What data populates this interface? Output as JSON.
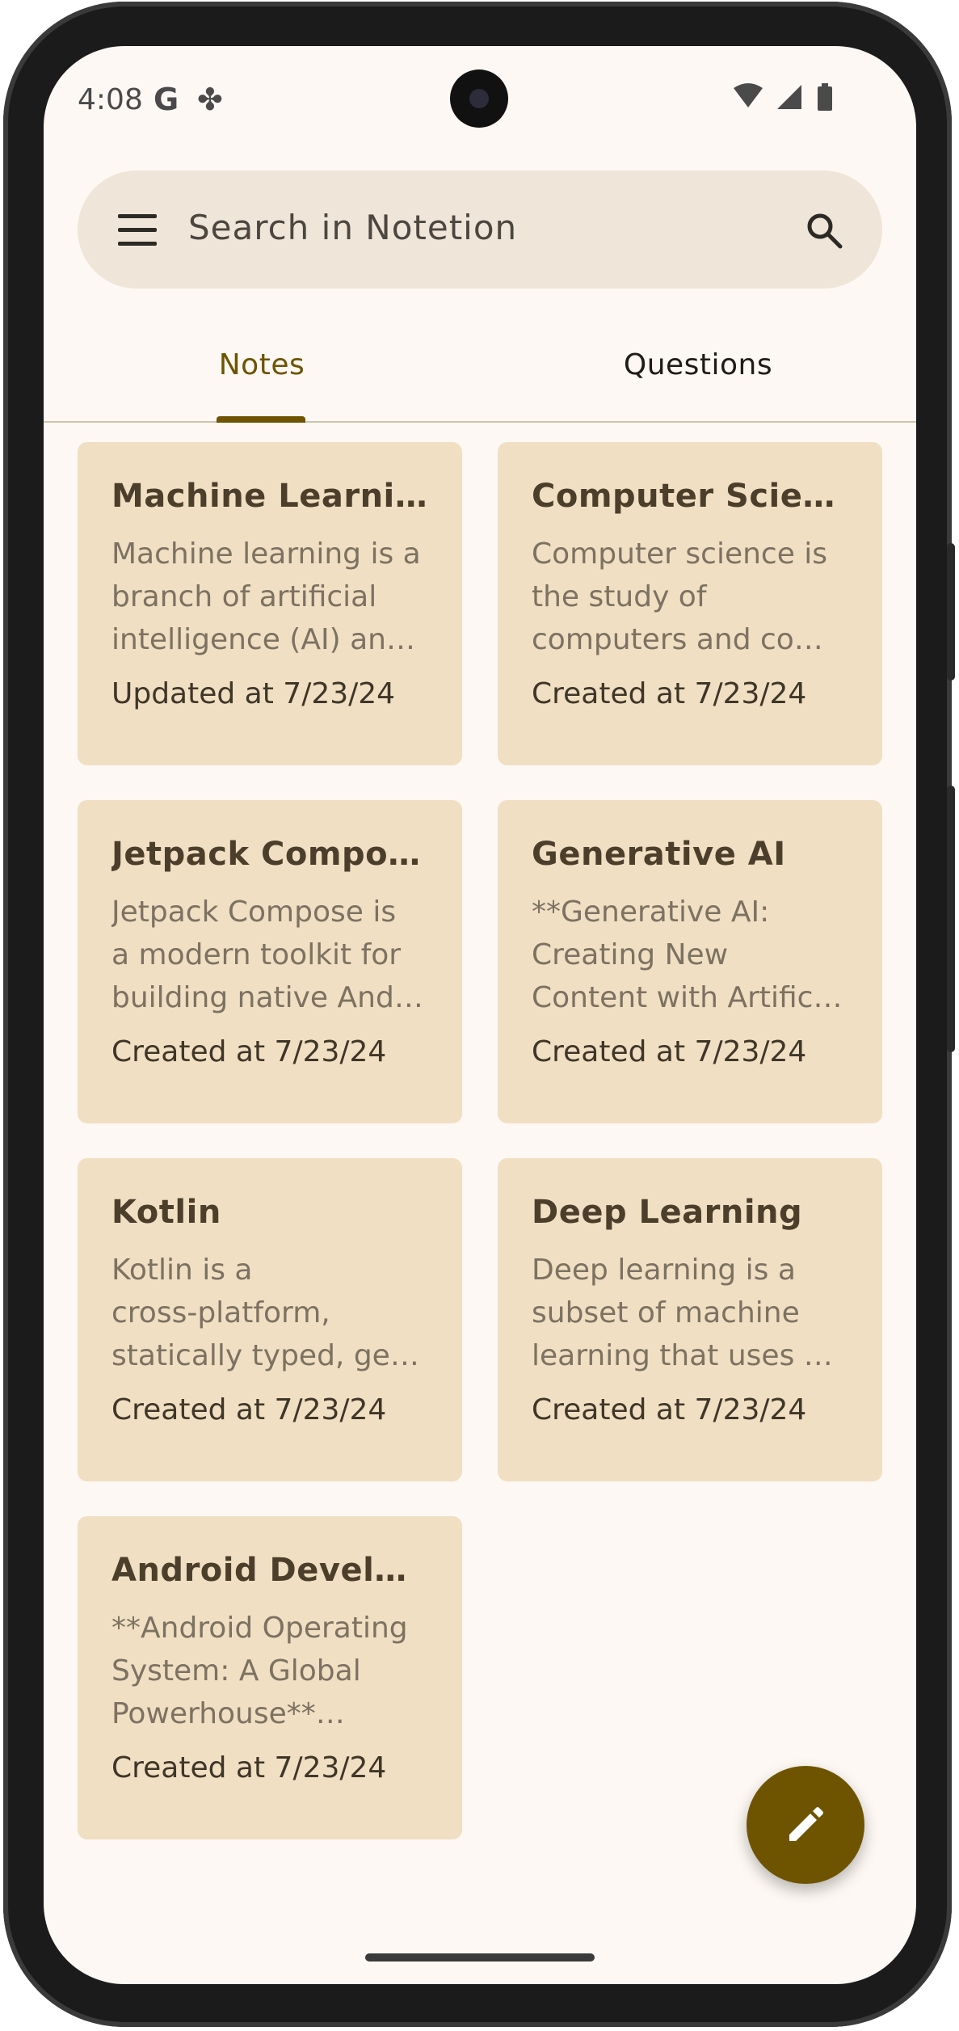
{
  "status_bar": {
    "time": "4:08",
    "icons_left": [
      "google-icon",
      "pinwheel-icon"
    ],
    "icons_right": [
      "wifi-icon",
      "signal-icon",
      "battery-icon"
    ]
  },
  "search": {
    "placeholder": "Search in Notetion"
  },
  "tabs": [
    {
      "label": "Notes",
      "selected": true
    },
    {
      "label": "Questions",
      "selected": false
    }
  ],
  "notes": [
    {
      "title": "Machine Learning",
      "lines": [
        "Machine learning is a",
        "branch of artificial",
        "intelligence (AI) an…"
      ],
      "date": "Updated at 7/23/24"
    },
    {
      "title": "Computer Science",
      "lines": [
        "Computer science is",
        "the study of",
        "computers and co…"
      ],
      "date": "Created at 7/23/24"
    },
    {
      "title": "Jetpack Compose",
      "lines": [
        "Jetpack Compose is",
        "a modern toolkit for",
        "building native And…"
      ],
      "date": "Created at 7/23/24"
    },
    {
      "title": "Generative AI",
      "lines": [
        "**Generative AI:",
        "Creating New",
        "Content with Artific…"
      ],
      "date": "Created at 7/23/24"
    },
    {
      "title": "Kotlin",
      "lines": [
        "Kotlin is a",
        "cross-platform,",
        "statically typed, ge…"
      ],
      "date": "Created at 7/23/24"
    },
    {
      "title": "Deep Learning",
      "lines": [
        "Deep learning is a",
        "subset of machine",
        "learning that uses …"
      ],
      "date": "Created at 7/23/24"
    },
    {
      "title": "Android Development",
      "lines": [
        "**Android Operating",
        "System: A Global",
        "Powerhouse**…"
      ],
      "date": "Created at 7/23/24"
    }
  ],
  "colors": {
    "background": "#fdf8f3",
    "card": "#f0dfc3",
    "accent": "#6e5400",
    "search_bar": "#efe5d8"
  },
  "fab": {
    "icon": "edit-pencil-icon"
  }
}
